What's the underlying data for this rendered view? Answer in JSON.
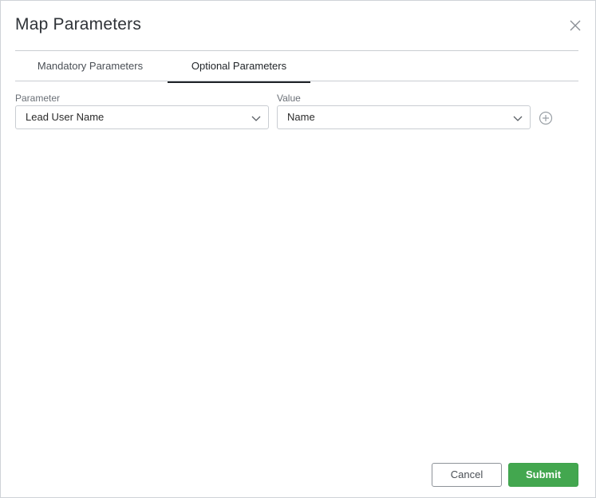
{
  "dialog": {
    "title": "Map Parameters",
    "close_icon": "close-icon"
  },
  "tabs": [
    {
      "label": "Mandatory Parameters",
      "active": false
    },
    {
      "label": "Optional Parameters",
      "active": true
    }
  ],
  "mapping": {
    "parameter_label": "Parameter",
    "parameter_value": "Lead User Name",
    "value_label": "Value",
    "value_value": "Name",
    "chevron_icon": "chevron-down-icon",
    "add_icon": "plus-circle-icon"
  },
  "footer": {
    "cancel_label": "Cancel",
    "submit_label": "Submit"
  },
  "colors": {
    "submit": "#43a74f",
    "active_tab_underline": "#1f2327",
    "border": "#c9cdd2"
  }
}
